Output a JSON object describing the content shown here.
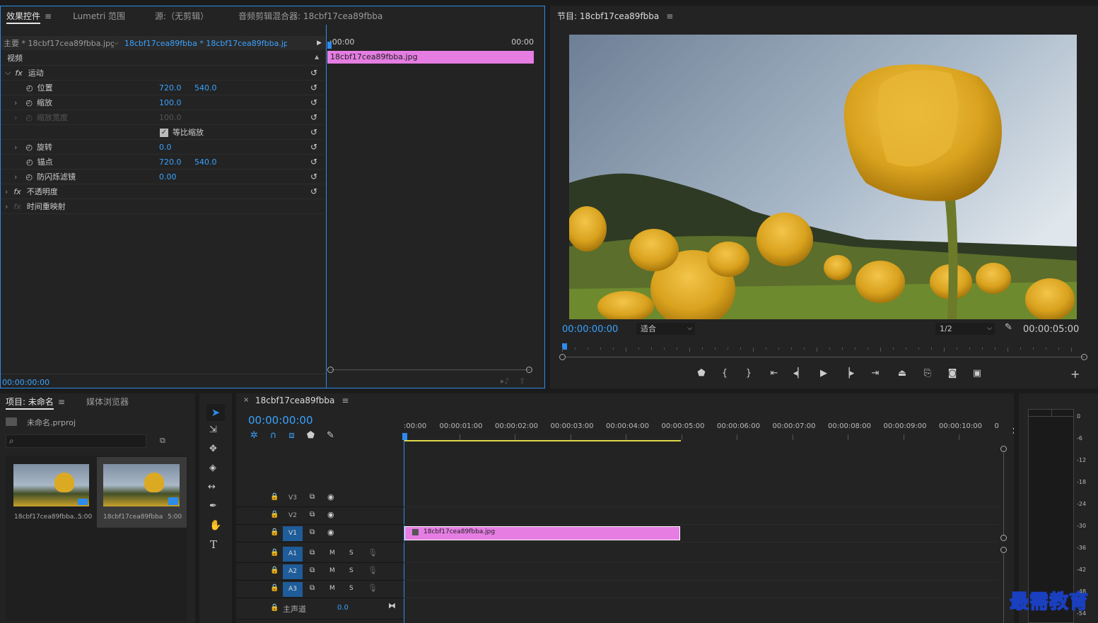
{
  "effects_panel": {
    "tabs": [
      "效果控件",
      "Lumetri 范围",
      "源:（无剪辑）",
      "音频剪辑混合器: 18cbf17cea89fbba"
    ],
    "master_label": "主要 * 18cbf17cea89fbba.jpg",
    "sequence_clip": "18cbf17cea89fbba * 18cbf17cea89fbba.jpg",
    "time_start": ":00:00",
    "time_end": "00:00",
    "clip_name": "18cbf17cea89fbba.jpg",
    "section_video": "视频",
    "motion": "运动",
    "position": {
      "label": "位置",
      "x": "720.0",
      "y": "540.0"
    },
    "scale": {
      "label": "缩放",
      "value": "100.0"
    },
    "scale_width": {
      "label": "缩放宽度",
      "value": "100.0"
    },
    "uniform_scale": "等比缩放",
    "rotation": {
      "label": "旋转",
      "value": "0.0"
    },
    "anchor": {
      "label": "锚点",
      "x": "720.0",
      "y": "540.0"
    },
    "flicker": {
      "label": "防闪烁滤镜",
      "value": "0.00"
    },
    "opacity": "不透明度",
    "time_remap": "时间重映射",
    "current_time": "00:00:00:00"
  },
  "program_monitor": {
    "title": "节目: 18cbf17cea89fbba",
    "timecode": "00:00:00:00",
    "fit": "适合",
    "resolution": "1/2",
    "duration": "00:00:05:00"
  },
  "project_panel": {
    "tabs": [
      "项目: 未命名",
      "媒体浏览器"
    ],
    "project_file": "未命名.prproj",
    "items": [
      {
        "name": "18cbf17cea89fbba....",
        "duration": "5:00"
      },
      {
        "name": "18cbf17cea89fbba",
        "duration": "5:00"
      }
    ]
  },
  "timeline": {
    "tab": "18cbf17cea89fbba",
    "timecode": "00:00:00:00",
    "ruler": [
      ":00:00",
      "00:00:01:00",
      "00:00:02:00",
      "00:00:03:00",
      "00:00:04:00",
      "00:00:05:00",
      "00:00:06:00",
      "00:00:07:00",
      "00:00:08:00",
      "00:00:09:00",
      "00:00:10:00",
      "0"
    ],
    "video_tracks": [
      "V3",
      "V2",
      "V1"
    ],
    "audio_tracks": [
      "A1",
      "A2",
      "A3"
    ],
    "mute": "M",
    "solo": "S",
    "master": "主声道",
    "master_value": "0.0",
    "clip": "18cbf17cea89fbba.jpg"
  },
  "meter": {
    "labels": [
      "0",
      "-6",
      "-12",
      "-18",
      "-24",
      "-30",
      "-36",
      "-42",
      "-48",
      "-54"
    ]
  },
  "watermark": "最需教育"
}
